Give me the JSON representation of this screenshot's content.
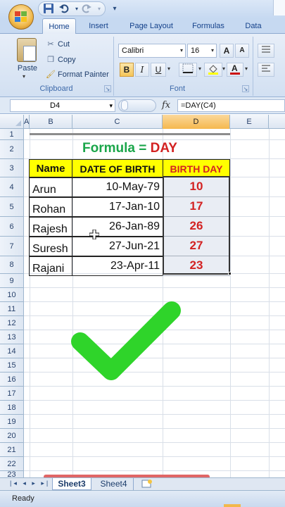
{
  "quick_access": {
    "customize_label": "▾"
  },
  "tabs": [
    "Home",
    "Insert",
    "Page Layout",
    "Formulas",
    "Data"
  ],
  "clipboard": {
    "paste_label": "Paste",
    "cut_label": "Cut",
    "copy_label": "Copy",
    "format_painter_label": "Format Painter",
    "group_label": "Clipboard"
  },
  "font": {
    "name": "Calibri",
    "size": "16",
    "grow_label": "A",
    "shrink_label": "A",
    "bold_label": "B",
    "italic_label": "I",
    "underline_label": "U",
    "group_label": "Font",
    "font_color": "#cc1111",
    "fill_color": "#ffff00"
  },
  "formula_bar": {
    "name_box": "D4",
    "fx_label": "fx",
    "formula": "=DAY(C4)"
  },
  "columns": [
    "A",
    "B",
    "C",
    "D",
    "E"
  ],
  "selected_column": "D",
  "rows": [
    "1",
    "2",
    "3",
    "4",
    "5",
    "6",
    "7",
    "8",
    "9",
    "10",
    "11",
    "12",
    "13",
    "14",
    "15",
    "16",
    "17",
    "18",
    "19",
    "20",
    "21",
    "22",
    "23"
  ],
  "sheet": {
    "title_prefix": "Formula = ",
    "title_func": "DAY",
    "title_prefix_color": "#1aa64a",
    "title_func_color": "#d32222",
    "headers": [
      "Name",
      "DATE OF BIRTH",
      "BIRTH DAY"
    ],
    "records": [
      {
        "name": "Arun",
        "dob": "10-May-79",
        "day": "10"
      },
      {
        "name": "Rohan",
        "dob": "17-Jan-10",
        "day": "17"
      },
      {
        "name": "Rajesh",
        "dob": "26-Jan-89",
        "day": "26"
      },
      {
        "name": "Suresh",
        "dob": "27-Jun-21",
        "day": "27"
      },
      {
        "name": "Rajani",
        "dob": "23-Apr-11",
        "day": "23"
      }
    ]
  },
  "overlay": {
    "checkmark_color": "#2fd42a"
  },
  "sheet_tabs": [
    "Sheet3",
    "Sheet4"
  ],
  "active_sheet": "Sheet3",
  "status": {
    "ready": "Ready"
  }
}
